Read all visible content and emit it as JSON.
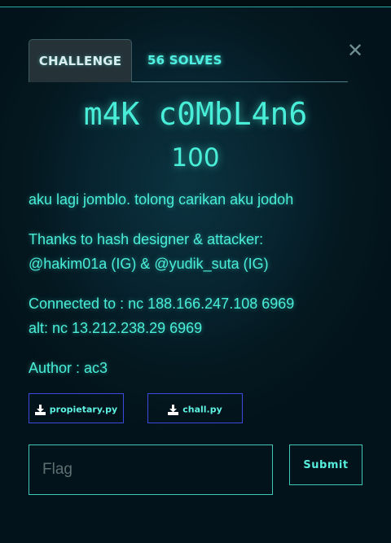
{
  "tabs": {
    "challenge_label": "CHALLENGE",
    "solves_label": "56 SOLVES"
  },
  "close_icon": "close-icon",
  "challenge": {
    "name": "m4K c0MbL4n6",
    "points": "100",
    "description": [
      "aku lagi jomblo. tolong carikan aku jodoh",
      "Thanks to hash designer & attacker:",
      "@hakim01a (IG) & @yudik_suta (IG)",
      "Connected to : nc 188.166.247.108 6969",
      "alt: nc 13.212.238.29 6969",
      "Author : ac3"
    ]
  },
  "files": [
    {
      "label": "propietary.py",
      "icon": "download-icon"
    },
    {
      "label": "chall.py",
      "icon": "download-icon"
    }
  ],
  "flag_form": {
    "placeholder": "Flag",
    "value": "",
    "submit_label": "Submit"
  },
  "colors": {
    "accent": "#49eed8",
    "background": "#03131b",
    "file_button_border": "#3a4ae0"
  }
}
